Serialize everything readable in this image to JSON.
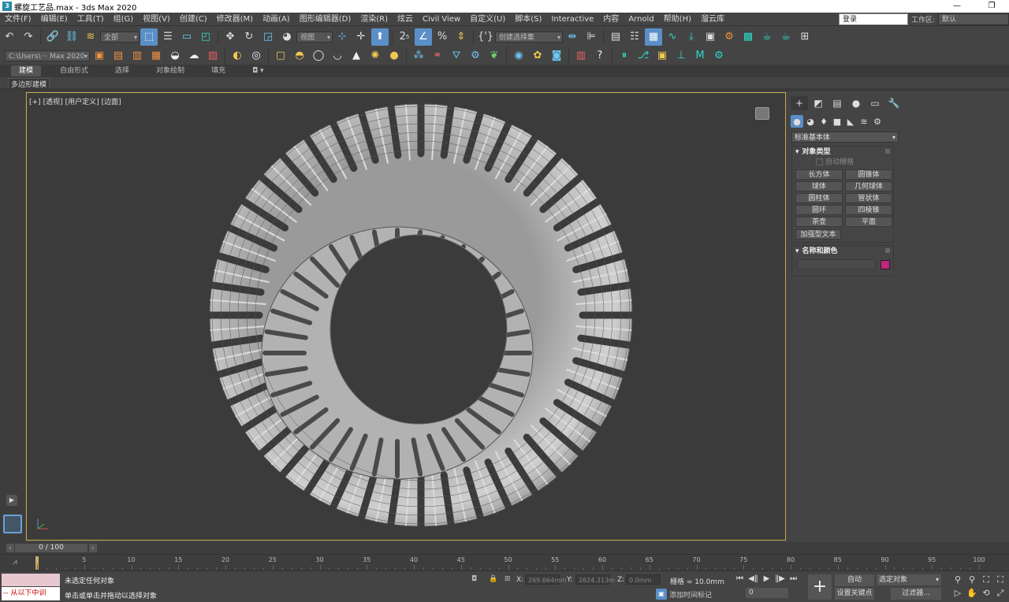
{
  "title": "螺旋工艺品.max - 3ds Max 2020",
  "title_icon": "3",
  "window_controls": [
    "—",
    "❐"
  ],
  "menu": [
    "文件(F)",
    "编辑(E)",
    "工具(T)",
    "组(G)",
    "视图(V)",
    "创建(C)",
    "修改器(M)",
    "动画(A)",
    "图形编辑器(D)",
    "渲染(R)",
    "炫云",
    "Civil View",
    "自定义(U)",
    "脚本(S)",
    "Interactive",
    "内容",
    "Arnold",
    "帮助(H)",
    "溜云库"
  ],
  "login": "登录",
  "workspace_label": "工作区:",
  "workspace_value": "默认",
  "toolbar1": {
    "selection_filter": "全部",
    "ref_coord": "视图",
    "named_set": "创建选择集",
    "snap_label": "2",
    "snap_sup": "5",
    "braces": "{'}"
  },
  "toolbar2": {
    "path": "C:\\Users\\··· Max 2020"
  },
  "ribbon_tabs": [
    "建模",
    "自由形式",
    "选择",
    "对象绘制",
    "填充"
  ],
  "ribbon_extra": "◘ ▾",
  "ribbon_sub": "多边形建模",
  "viewport": {
    "label_plus": "[+]",
    "label_view": "[透视]",
    "label_custom": "[用户定义]",
    "label_shading": "[边面]"
  },
  "command_panel": {
    "tabs": [
      "+",
      "◩",
      "▤",
      "●",
      "▭",
      "🔧"
    ],
    "category_icons": [
      "●",
      "◕",
      "♦",
      "■",
      "◣",
      "≋",
      "⚙"
    ],
    "type_dropdown": "标准基本体",
    "rollout_object_type": "对象类型",
    "autogrid": "自动栅格",
    "buttons": [
      "长方体",
      "圆锥体",
      "球体",
      "几何球体",
      "圆柱体",
      "管状体",
      "圆环",
      "四棱锥",
      "茶壶",
      "平面"
    ],
    "textplus": "加强型文本",
    "rollout_name_color": "名称和颜色",
    "object_color": "#c0267a"
  },
  "timeline": {
    "frame_display": "0 / 100",
    "ticks": [
      0,
      5,
      10,
      15,
      20,
      25,
      30,
      35,
      40,
      45,
      50,
      55,
      60,
      65,
      70,
      75,
      80,
      85,
      90,
      95,
      100
    ],
    "current_frame": 0,
    "total_frames": 100
  },
  "status": {
    "maxscript_text": "-- 从以下中训",
    "line1": "未选定任何对象",
    "line2": "单击或单击并拖动以选择对象",
    "x_label": "X:",
    "x_value": "269.664mm",
    "y_label": "Y:",
    "y_value": "2624.313m",
    "z_label": "Z:",
    "z_value": "0.0mm",
    "grid": "栅格 = 10.0mm",
    "add_time_tag": "添加时间标记",
    "frame_spinner": "0",
    "auto_key": "自动",
    "set_key": "设置关键点",
    "selected_object": "选定对象",
    "filters": "过滤器..."
  },
  "colors": {
    "ui_bg": "#444444",
    "viewport_bg": "#3b3b3b",
    "active_blue": "#5b8fc7",
    "viewport_border": "#c9a84f"
  }
}
